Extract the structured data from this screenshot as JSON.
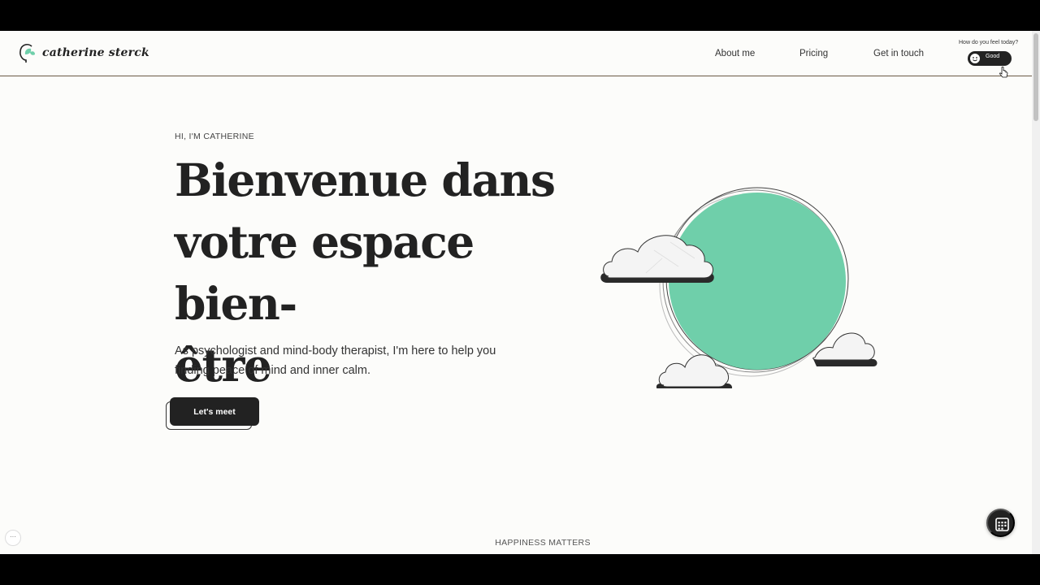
{
  "brand": {
    "name": "catherine sterck",
    "icon": "head-with-leaf-logo",
    "accent_color": "#6fcfaa"
  },
  "nav": [
    {
      "label": "About me"
    },
    {
      "label": "Pricing"
    },
    {
      "label": "Get in touch"
    }
  ],
  "mood": {
    "question": "How do you feel today?",
    "value": "Good",
    "icon": "smiley-face-icon"
  },
  "hero": {
    "eyebrow": "HI, I'M CATHERINE",
    "headline_lines": [
      "Bienvenue dans",
      "votre espace bien-",
      "être"
    ],
    "subtitle": "As psychologist and mind-body therapist, I'm here to help you finding peace of mind and inner calm.",
    "cta": "Let's meet"
  },
  "section_label": "HAPPINESS MATTERS",
  "floating": {
    "calendar_icon": "calendar-grid-icon",
    "menu_icon": "more-dots-icon",
    "menu_glyph": "···"
  },
  "colors": {
    "dark": "#222222",
    "background": "#fcfcfa",
    "sun": "#6fcfaa"
  }
}
